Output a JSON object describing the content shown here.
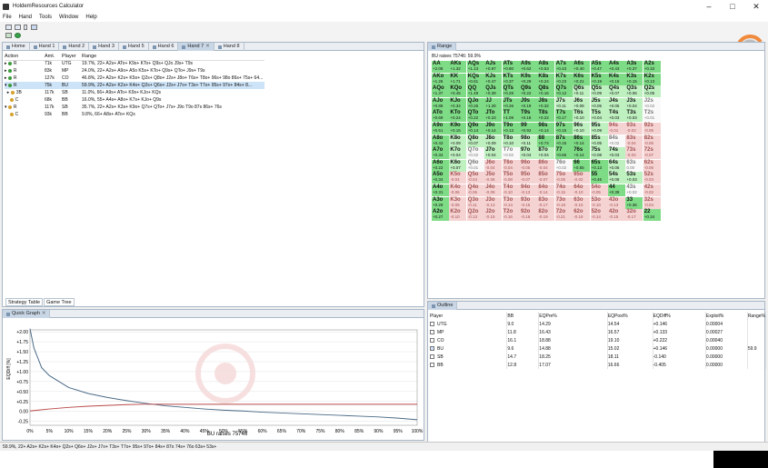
{
  "window": {
    "title": "HoldemResources Calculator"
  },
  "menu": [
    "File",
    "Hand",
    "Tools",
    "Window",
    "Help"
  ],
  "hand_tabs": [
    "Home",
    "Hand 1",
    "Hand 2",
    "Hand 3",
    "Hand 5",
    "Hand 6",
    "Hand 7",
    "Hand 8"
  ],
  "action_table": {
    "headers": [
      "Action",
      "Amt.",
      "Player",
      "Range"
    ],
    "rows": [
      {
        "action": "R",
        "amt": "71k",
        "player": "UTG",
        "range": "19.7%, 22+ A2s+ ATo+ K9s+ KTo+ Q9s+ QJo J9s+ T9s"
      },
      {
        "action": "R",
        "amt": "83k",
        "player": "MP",
        "range": "24.0%, 22+ A2s+ A9o+ A5o K5s+ KTo+ Q9s+ QTo+ J9s+ T9s"
      },
      {
        "action": "R",
        "amt": "127k",
        "player": "CO",
        "range": "46.8%, 22+ A2s+ K2s+ K5o+ Q2s+ Q8o+ J2s+ J8o+ T6s+ T8o+ 96s+ 98o 86s+ 75s+ 64..."
      },
      {
        "action": "R",
        "amt": "75k",
        "player": "BU",
        "range": "59.9%, 22+ A2s+ K2s+ K4o+ Q2s+ Q6o+ J2s+ J7o+ T3s+ T7o+ 95s+ 97o+ 84s+ 8..."
      },
      {
        "action": "3B",
        "amt": "117k",
        "player": "SB",
        "range": "11.0%, 66+ A9s+ ATo+ K9s+ KJo+ KQs"
      },
      {
        "action": "C",
        "amt": "68k",
        "player": "BB",
        "range": "16.0%, 55+ A4s+ A8o+ K7s+ KJo+ Q9s"
      },
      {
        "action": "R",
        "amt": "117k",
        "player": "SB",
        "range": "35.7%, 22+ A2s+ K3s+ K9o+ Q7s+ QTo+ J7s+ J9o T9o 87s 86s+ 76s"
      },
      {
        "action": "C",
        "amt": "93k",
        "player": "BB",
        "range": "9.8%, 66+ A8s+ ATo+ KQs"
      }
    ]
  },
  "bottom_tabs": [
    "Strategy Table",
    "Game Tree"
  ],
  "range_panel": {
    "tab": "Range",
    "header": "BU raises 75746: 59.9%"
  },
  "range_grid": [
    [
      [
        "AA",
        "+2.08"
      ],
      [
        "AKs",
        "+1.32"
      ],
      [
        "AQs",
        "+1.13"
      ],
      [
        "AJs",
        "+0.97"
      ],
      [
        "ATs",
        "+0.80"
      ],
      [
        "A9s",
        "+0.62"
      ],
      [
        "A8s",
        "+0.53"
      ],
      [
        "A7s",
        "+0.43"
      ],
      [
        "A6s",
        "+0.40"
      ],
      [
        "A5s",
        "+0.47"
      ],
      [
        "A4s",
        "+0.43"
      ],
      [
        "A3s",
        "+0.37"
      ],
      [
        "A2s",
        "+0.33"
      ]
    ],
    [
      [
        "AKo",
        "+1.26"
      ],
      [
        "KK",
        "+1.71"
      ],
      [
        "KQs",
        "+0.61"
      ],
      [
        "KJs",
        "+0.47"
      ],
      [
        "KTs",
        "+0.37"
      ],
      [
        "K9s",
        "+0.29"
      ],
      [
        "K8s",
        "+0.24"
      ],
      [
        "K7s",
        "+0.23"
      ],
      [
        "K6s",
        "+0.21"
      ],
      [
        "K5s",
        "+0.19"
      ],
      [
        "K4s",
        "+0.16"
      ],
      [
        "K3s",
        "+0.15"
      ],
      [
        "K2s",
        "+0.13"
      ]
    ],
    [
      [
        "AQo",
        "+1.37"
      ],
      [
        "KQo",
        "+0.45"
      ],
      [
        "QQ",
        "+1.49"
      ],
      [
        "QJs",
        "+0.39"
      ],
      [
        "QTs",
        "+0.28"
      ],
      [
        "Q9s",
        "+0.22"
      ],
      [
        "Q8s",
        "+0.16"
      ],
      [
        "Q7s",
        "+0.12"
      ],
      [
        "Q6s",
        "+0.11"
      ],
      [
        "Q5s",
        "+0.09"
      ],
      [
        "Q4s",
        "+0.07"
      ],
      [
        "Q3s",
        "+0.06"
      ],
      [
        "Q2s",
        "+0.05"
      ]
    ],
    [
      [
        "AJo",
        "+0.88"
      ],
      [
        "KJo",
        "+0.34"
      ],
      [
        "QJo",
        "+0.25"
      ],
      [
        "JJ",
        "+1.28"
      ],
      [
        "JTs",
        "+0.26"
      ],
      [
        "J9s",
        "+0.19"
      ],
      [
        "J8s",
        "+0.32"
      ],
      [
        "J7s",
        "+0.11"
      ],
      [
        "J6s",
        "+0.08"
      ],
      [
        "J5s",
        "+0.05"
      ],
      [
        "J4s",
        "+0.05"
      ],
      [
        "J3s",
        "+0.04"
      ],
      [
        "J2s",
        "+0.02"
      ]
    ],
    [
      [
        "ATo",
        "+0.69"
      ],
      [
        "KTo",
        "+0.24"
      ],
      [
        "QTo",
        "+0.22"
      ],
      [
        "JTo",
        "+0.23"
      ],
      [
        "TT",
        "+1.09"
      ],
      [
        "T9s",
        "+0.18"
      ],
      [
        "T8s",
        "+0.22"
      ],
      [
        "T7s",
        "+0.17"
      ],
      [
        "T6s",
        "+0.10"
      ],
      [
        "T5s",
        "+0.04"
      ],
      [
        "T4s",
        "+0.03"
      ],
      [
        "T3s",
        "+0.03"
      ],
      [
        "T2s",
        "+0.01"
      ]
    ],
    [
      [
        "A9o",
        "+0.51"
      ],
      [
        "K9o",
        "+0.15"
      ],
      [
        "Q9o",
        "+0.14"
      ],
      [
        "J9o",
        "+0.14"
      ],
      [
        "T9o",
        "+0.13"
      ],
      [
        "99",
        "+0.92"
      ],
      [
        "98s",
        "+0.14"
      ],
      [
        "97s",
        "+0.15"
      ],
      [
        "96s",
        "+0.10"
      ],
      [
        "95s",
        "+0.09"
      ],
      [
        "94s",
        "-0.01"
      ],
      [
        "93s",
        "-0.03"
      ],
      [
        "92s",
        "-0.05"
      ]
    ],
    [
      [
        "A8o",
        "+0.43"
      ],
      [
        "K8o",
        "+0.09"
      ],
      [
        "Q8o",
        "+0.07"
      ],
      [
        "J8o",
        "+0.09"
      ],
      [
        "T8o",
        "+0.10"
      ],
      [
        "98o",
        "+0.11"
      ],
      [
        "88",
        "+0.74"
      ],
      [
        "87s",
        "+0.15"
      ],
      [
        "86s",
        "+0.14"
      ],
      [
        "85s",
        "+0.05"
      ],
      [
        "84s",
        "+0.02"
      ],
      [
        "83s",
        "-0.04"
      ],
      [
        "82s",
        "-0.06"
      ]
    ],
    [
      [
        "A7o",
        "+0.34"
      ],
      [
        "K7o",
        "+0.04"
      ],
      [
        "Q7o",
        "+0.02"
      ],
      [
        "J7o",
        "+0.04"
      ],
      [
        "T7o",
        "+0.02"
      ],
      [
        "97o",
        "+0.04"
      ],
      [
        "87o",
        "+0.04"
      ],
      [
        "77",
        "+0.65"
      ],
      [
        "76s",
        "+0.14"
      ],
      [
        "75s",
        "+0.08"
      ],
      [
        "74s",
        "+0.03"
      ],
      [
        "73s",
        "-0.03"
      ],
      [
        "72s",
        "-0.07"
      ]
    ],
    [
      [
        "A6o",
        "+0.22"
      ],
      [
        "K6o",
        "+0.07"
      ],
      [
        "Q6o",
        "+0.01"
      ],
      [
        "J6o",
        "-0.04"
      ],
      [
        "T6o",
        "-0.04"
      ],
      [
        "96o",
        "-0.05"
      ],
      [
        "86o",
        "-0.04"
      ],
      [
        "76o",
        "+0.02"
      ],
      [
        "66",
        "+0.55"
      ],
      [
        "65s",
        "+0.13"
      ],
      [
        "64s",
        "+0.06"
      ],
      [
        "63s",
        "0.00"
      ],
      [
        "62s",
        "-0.06"
      ]
    ],
    [
      [
        "A5o",
        "+0.34"
      ],
      [
        "K5o",
        "-0.04"
      ],
      [
        "Q5o",
        "-0.04"
      ],
      [
        "J5o",
        "-0.06"
      ],
      [
        "T5o",
        "-0.08"
      ],
      [
        "95o",
        "-0.07"
      ],
      [
        "85o",
        "-0.07"
      ],
      [
        "75o",
        "-0.05"
      ],
      [
        "65o",
        "-0.02"
      ],
      [
        "55",
        "+0.46"
      ],
      [
        "54s",
        "+0.08"
      ],
      [
        "53s",
        "+0.03"
      ],
      [
        "52s",
        "-0.03"
      ]
    ],
    [
      [
        "A4o",
        "+0.31"
      ],
      [
        "K4o",
        "-0.06"
      ],
      [
        "Q4o",
        "-0.06"
      ],
      [
        "J4o",
        "-0.09"
      ],
      [
        "T4o",
        "-0.10"
      ],
      [
        "94o",
        "-0.13"
      ],
      [
        "84o",
        "-0.14"
      ],
      [
        "74o",
        "-0.15"
      ],
      [
        "64o",
        "-0.10"
      ],
      [
        "54o",
        "-0.05"
      ],
      [
        "44",
        "+0.39"
      ],
      [
        "43s",
        "+0.02"
      ],
      [
        "42s",
        "-0.02"
      ]
    ],
    [
      [
        "A3o",
        "+0.29"
      ],
      [
        "K3o",
        "-0.08"
      ],
      [
        "Q3o",
        "-0.11"
      ],
      [
        "J3o",
        "-0.13"
      ],
      [
        "T3o",
        "-0.14"
      ],
      [
        "93o",
        "-0.16"
      ],
      [
        "83o",
        "-0.17"
      ],
      [
        "73o",
        "-0.18"
      ],
      [
        "63o",
        "-0.15"
      ],
      [
        "53o",
        "-0.10"
      ],
      [
        "43o",
        "-0.13"
      ],
      [
        "33",
        "+0.36"
      ],
      [
        "32s",
        "-0.04"
      ]
    ],
    [
      [
        "A2o",
        "+0.27"
      ],
      [
        "K2o",
        "-0.10"
      ],
      [
        "Q2o",
        "-0.13"
      ],
      [
        "J2o",
        "-0.15"
      ],
      [
        "T2o",
        "-0.16"
      ],
      [
        "92o",
        "-0.18"
      ],
      [
        "82o",
        "-0.19"
      ],
      [
        "72o",
        "-0.21"
      ],
      [
        "62o",
        "-0.18"
      ],
      [
        "52o",
        "-0.14"
      ],
      [
        "42o",
        "-0.15"
      ],
      [
        "32o",
        "-0.17"
      ],
      [
        "22",
        "+0.34"
      ]
    ]
  ],
  "quick_graph": {
    "tab": "Quick Graph"
  },
  "chart_data": {
    "type": "line",
    "xlabel": "BU raises 75746",
    "ylabel": "EQDiff [%]",
    "x_ticks": [
      "0%",
      "5%",
      "10%",
      "15%",
      "20%",
      "25%",
      "30%",
      "35%",
      "40%",
      "45%",
      "50%",
      "55%",
      "60%",
      "65%",
      "70%",
      "75%",
      "80%",
      "85%",
      "90%",
      "95%",
      "100%"
    ],
    "y_ticks": [
      "+2.00",
      "+1.75",
      "+1.50",
      "+1.25",
      "+1.00",
      "+0.75",
      "+0.50",
      "+0.25",
      "0.00",
      "-0.25"
    ],
    "ylim": [
      -0.35,
      2.05
    ],
    "xlim": [
      0,
      100
    ],
    "series": [
      {
        "color": "#4a6a86",
        "x": [
          0,
          1,
          2,
          3,
          5,
          8,
          10,
          15,
          20,
          25,
          30,
          35,
          40,
          45,
          50,
          55,
          60,
          65,
          70,
          75,
          80,
          85,
          90,
          95,
          100
        ],
        "y": [
          2.08,
          1.6,
          1.35,
          1.1,
          0.9,
          0.72,
          0.6,
          0.45,
          0.35,
          0.27,
          0.2,
          0.14,
          0.1,
          0.06,
          0.03,
          0.01,
          -0.02,
          -0.04,
          -0.06,
          -0.08,
          -0.1,
          -0.12,
          -0.14,
          -0.17,
          -0.21
        ]
      },
      {
        "color": "#b84848",
        "x": [
          0,
          2,
          5,
          10,
          15,
          20,
          25,
          30,
          35,
          40,
          45,
          50,
          55,
          60,
          65,
          70,
          75,
          80,
          85,
          90,
          95,
          100
        ],
        "y": [
          0.01,
          0.03,
          0.06,
          0.1,
          0.13,
          0.15,
          0.17,
          0.18,
          0.18,
          0.18,
          0.18,
          0.18,
          0.18,
          0.18,
          0.18,
          0.18,
          0.18,
          0.18,
          0.18,
          0.18,
          0.18,
          0.18
        ]
      }
    ]
  },
  "outline": {
    "tab": "Outline",
    "headers": [
      "Player",
      "BB",
      "EQPre%",
      "EQPost%",
      "EQDiff%",
      "Exploit%",
      "Range%"
    ],
    "rows": [
      {
        "player": "UTG",
        "bb": "9.0",
        "pre": "14.29",
        "post": "14.54",
        "diff": "+0.146",
        "exploit": "0.00004",
        "range": "",
        "checked": false
      },
      {
        "player": "MP",
        "bb": "11.8",
        "pre": "16.43",
        "post": "16.57",
        "diff": "+0.133",
        "exploit": "0.00027",
        "range": "",
        "checked": false
      },
      {
        "player": "CO",
        "bb": "16.1",
        "pre": "18.88",
        "post": "19.10",
        "diff": "+0.222",
        "exploit": "0.00040",
        "range": "",
        "checked": false
      },
      {
        "player": "BU",
        "bb": "9.6",
        "pre": "14.88",
        "post": "15.02",
        "diff": "+0.146",
        "exploit": "0.00000",
        "range": "59.9",
        "checked": true
      },
      {
        "player": "SB",
        "bb": "14.7",
        "pre": "18.25",
        "post": "18.11",
        "diff": "-0.140",
        "exploit": "0.00000",
        "range": "",
        "checked": false
      },
      {
        "player": "BB",
        "bb": "12.8",
        "pre": "17.07",
        "post": "16.66",
        "diff": "-0.405",
        "exploit": "0.00000",
        "range": "",
        "checked": false
      }
    ]
  },
  "statusbar": {
    "text": "59.9%, 22+ A2s+ K2s+ K4o+ Q2s+ Q6o+ J2s+ J7o+ T3s+ T7o+ 95s+ 97o+ 84s+ 87o 74s+ 76o 63s+ 53s+"
  }
}
